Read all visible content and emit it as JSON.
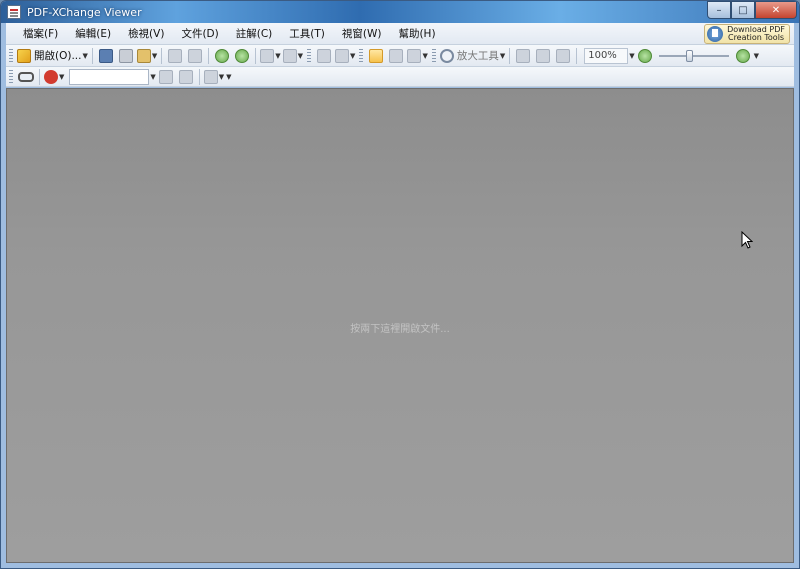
{
  "window": {
    "title": "PDF-XChange Viewer"
  },
  "window_controls": {
    "minimize": "–",
    "maximize": "□",
    "close": "✕"
  },
  "menu": {
    "items": [
      "檔案(F)",
      "編輯(E)",
      "檢視(V)",
      "文件(D)",
      "註解(C)",
      "工具(T)",
      "視窗(W)",
      "幫助(H)"
    ],
    "promo_line1": "Download PDF",
    "promo_line2": "Creation Tools"
  },
  "toolbar": {
    "open_label": "開啟(O)...",
    "zoom_tool_label": "放大工具",
    "zoom_level": "100%"
  },
  "document": {
    "empty_message": "按兩下這裡開啟文件..."
  },
  "icons": {
    "open": "folder-open-icon",
    "save": "save-icon",
    "print": "printer-icon",
    "email": "email-icon",
    "back": "back-icon",
    "forward": "forward-icon",
    "hand": "hand-tool-icon",
    "zoom": "magnifier-icon",
    "zoom_out": "zoom-out-icon",
    "zoom_in": "zoom-in-icon",
    "stamp": "stamp-icon",
    "glasses": "glasses-icon"
  }
}
